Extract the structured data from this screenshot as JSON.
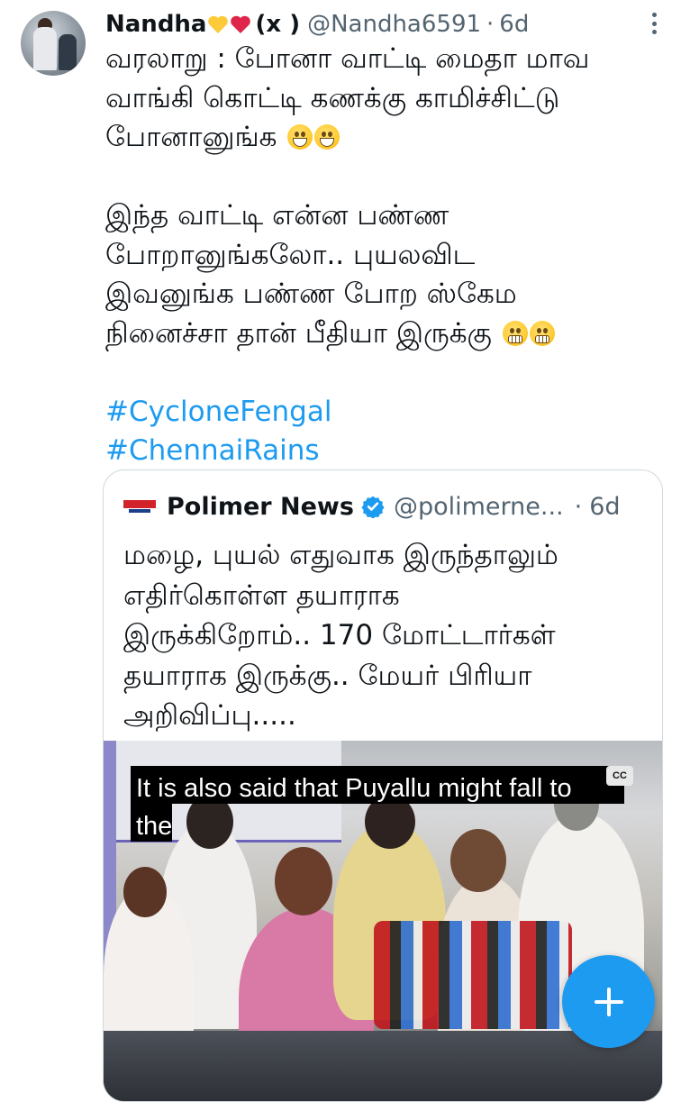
{
  "tweet": {
    "author_name": "Nandha",
    "author_suffix": "(x )",
    "handle": "@Nandha6591",
    "separator": "·",
    "time": "6d",
    "lines": [
      "வரலாறு : போனா வாட்டி மைதா மாவ",
      "வாங்கி கொட்டி கணக்கு காமிச்சிட்டு",
      "போனானுங்க"
    ],
    "lines2": [
      "இந்த வாட்டி என்ன பண்ண",
      "போறானுங்கலோ.. புயலவிட",
      "இவனுங்க பண்ண போற ஸ்கேம",
      "நினைச்சா தான் பீதியா இருக்கு"
    ],
    "hashtags": [
      "#CycloneFengal",
      "#ChennaiRains"
    ]
  },
  "quote": {
    "name": "Polimer News",
    "handle": "@polimerne...",
    "separator": "·",
    "time": "6d",
    "lines": [
      "மழை, புயல் எதுவாக இருந்தாலும்",
      "எதிர்கொள்ள தயாராக",
      "இருக்கிறோம்.. 170 மோட்டார்கள்",
      "தயாராக இருக்கு.. மேயர் பிரியா",
      "அறிவிப்பு....."
    ],
    "video": {
      "caption_line1": "It is also said that Puyallu might fall to",
      "caption_line2": "the",
      "cc_label": "CC"
    }
  },
  "fab": {
    "icon": "plus-icon"
  },
  "colors": {
    "accent": "#1d9bf0",
    "secondary_text": "#536471",
    "border": "#cfd9de"
  }
}
